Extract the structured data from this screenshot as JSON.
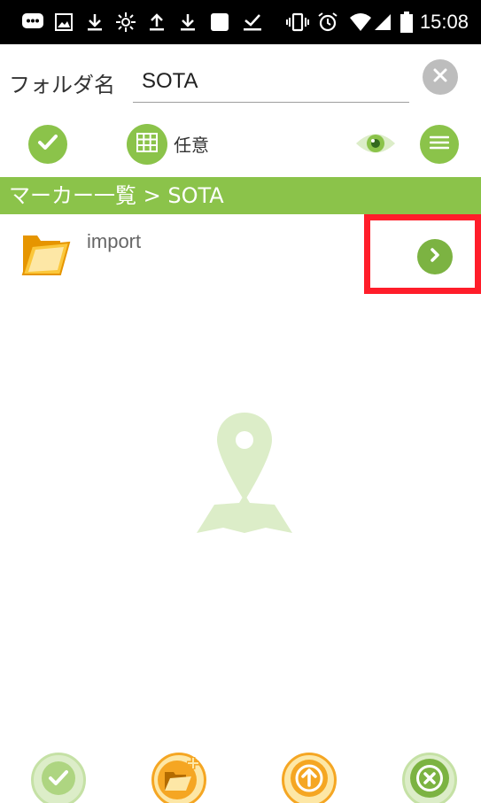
{
  "status_bar": {
    "icons": [
      "chat-icon",
      "image-icon",
      "download-icon",
      "brightness-icon",
      "upload-icon",
      "download-icon",
      "square-icon",
      "check-download-icon",
      "vibrate-icon",
      "alarm-icon",
      "wifi-icon",
      "signal-icon",
      "battery-icon"
    ],
    "time": "15:08"
  },
  "folder": {
    "label": "フォルダ名",
    "value": "SOTA"
  },
  "toolbar": {
    "sort_label": "任意",
    "icons": [
      "check-icon",
      "grid-icon",
      "eye-icon",
      "menu-icon"
    ]
  },
  "breadcrumb": {
    "text": "マーカー一覧 > SOTA"
  },
  "list": {
    "items": [
      {
        "label": "import",
        "icon": "folder-icon",
        "action_icon": "chevron-right-icon"
      }
    ]
  },
  "bottom_bar": {
    "icons": [
      "check-icon",
      "new-folder-icon",
      "arrow-up-icon",
      "close-icon"
    ]
  },
  "colors": {
    "accent_green": "#8bc34a",
    "orange": "#f5a623",
    "highlight_red": "#ff1d2a",
    "placeholder_green": "#dcedc8"
  }
}
